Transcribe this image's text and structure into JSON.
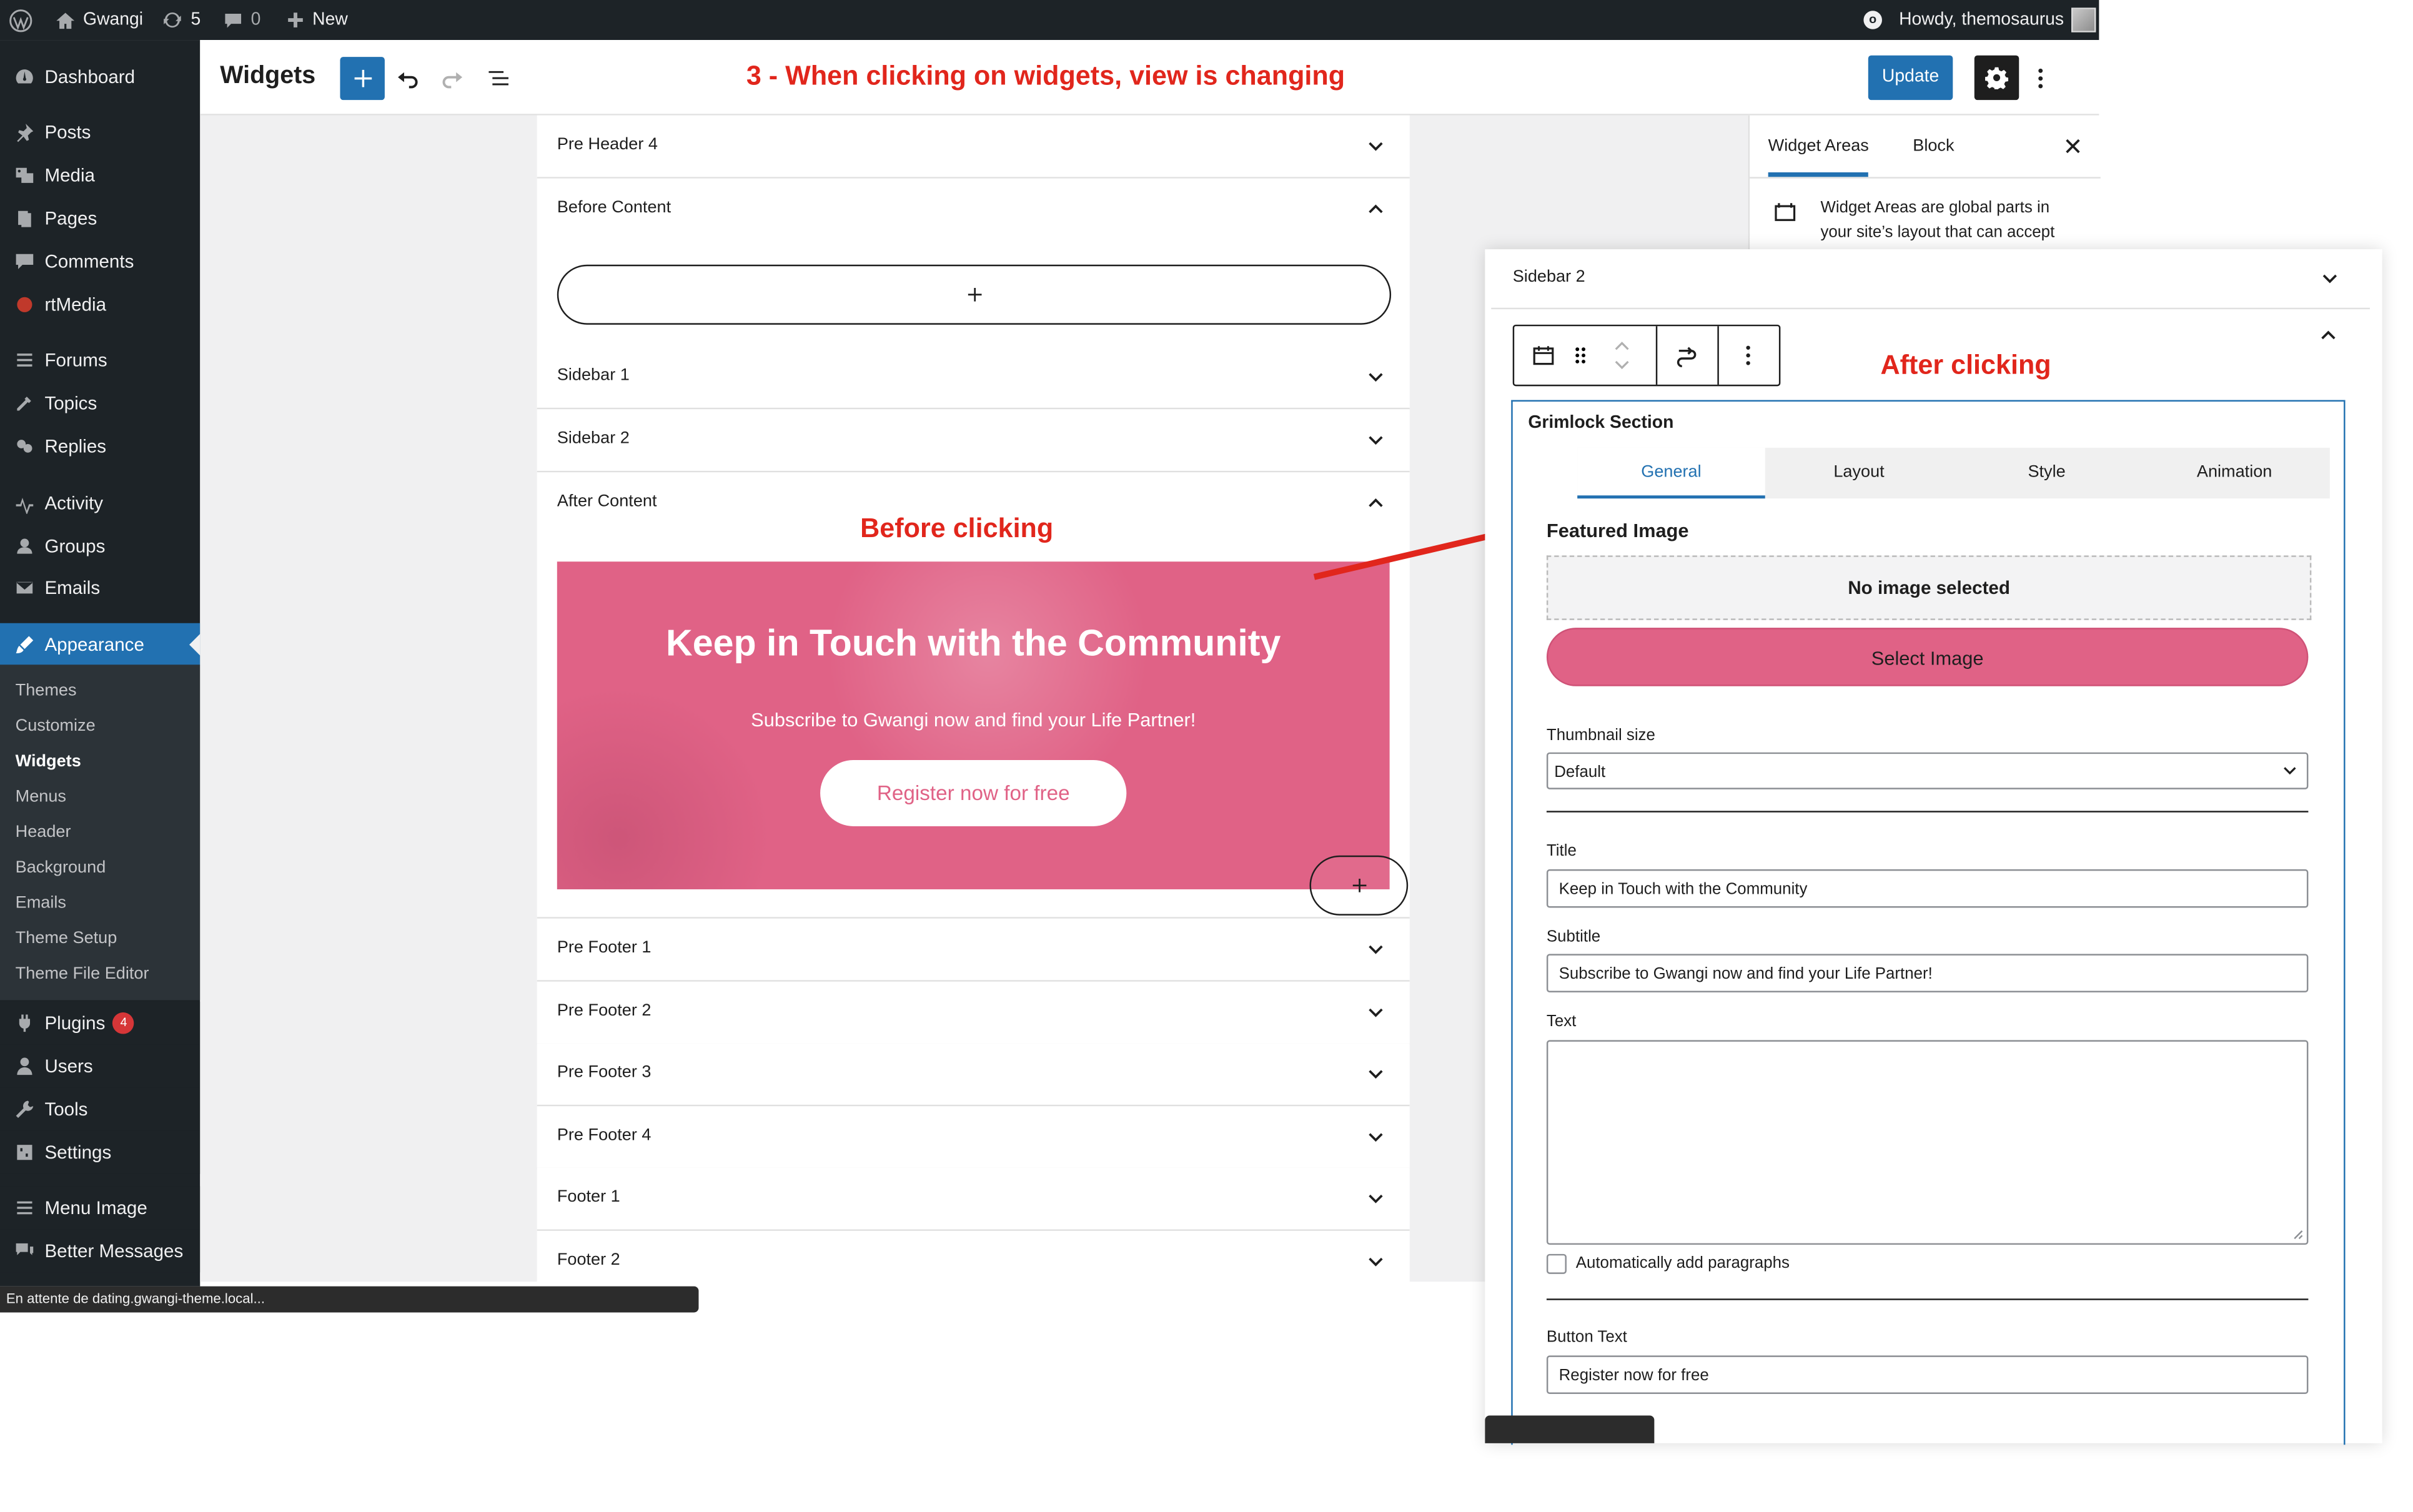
{
  "adminbar": {
    "site_name": "Gwangi",
    "updates_count": "5",
    "comments_count": "0",
    "new_label": "New",
    "howdy": "Howdy, themosaurus"
  },
  "menu": {
    "items": [
      {
        "label": "Dashboard",
        "icon": "dashboard-icon"
      },
      {
        "label": "Posts",
        "icon": "pin-icon"
      },
      {
        "label": "Media",
        "icon": "media-icon"
      },
      {
        "label": "Pages",
        "icon": "pages-icon"
      },
      {
        "label": "Comments",
        "icon": "comment-icon"
      },
      {
        "label": "rtMedia",
        "icon": "rtmedia-icon"
      },
      {
        "label": "Forums",
        "icon": "forums-icon"
      },
      {
        "label": "Topics",
        "icon": "topics-icon"
      },
      {
        "label": "Replies",
        "icon": "replies-icon"
      },
      {
        "label": "Activity",
        "icon": "activity-icon"
      },
      {
        "label": "Groups",
        "icon": "groups-icon"
      },
      {
        "label": "Emails",
        "icon": "email-icon"
      },
      {
        "label": "Appearance",
        "icon": "brush-icon"
      },
      {
        "label": "Plugins",
        "icon": "plugin-icon",
        "badge": "4"
      },
      {
        "label": "Users",
        "icon": "user-icon"
      },
      {
        "label": "Tools",
        "icon": "wrench-icon"
      },
      {
        "label": "Settings",
        "icon": "settings-icon"
      },
      {
        "label": "Menu Image",
        "icon": "menu-icon"
      },
      {
        "label": "Better Messages",
        "icon": "messages-icon"
      }
    ],
    "submenu": [
      "Themes",
      "Customize",
      "Widgets",
      "Menus",
      "Header",
      "Background",
      "Emails",
      "Theme Setup",
      "Theme File Editor"
    ]
  },
  "editor": {
    "title": "Widgets",
    "update_label": "Update",
    "annotation_top": "3 - When clicking on widgets, view is changing",
    "annotation_before": "Before clicking",
    "annotation_after": "After clicking"
  },
  "areas": [
    "Pre Header 4",
    "Before Content",
    "Sidebar 1",
    "Sidebar 2",
    "After Content",
    "Pre Footer 1",
    "Pre Footer 2",
    "Pre Footer 3",
    "Pre Footer 4",
    "Footer 1",
    "Footer 2"
  ],
  "banner": {
    "title": "Keep in Touch with the Community",
    "subtitle": "Subscribe to Gwangi now and find your Life Partner!",
    "button": "Register now for free",
    "color": "#e06286"
  },
  "statusbar": "En attente de dating.gwangi-theme.local...",
  "sidebar": {
    "tabs": [
      "Widget Areas",
      "Block"
    ],
    "description": "Widget Areas are global parts in your site’s layout that can accept"
  },
  "overlay": {
    "area_label": "Sidebar 2",
    "block_title": "Grimlock Section",
    "tabs": [
      "General",
      "Layout",
      "Style",
      "Animation"
    ],
    "featured_image": "Featured Image",
    "no_image": "No image selected",
    "select_image": "Select Image",
    "thumbnail_label": "Thumbnail size",
    "thumbnail_value": "Default",
    "title_label": "Title",
    "title_value": "Keep in Touch with the Community",
    "subtitle_label": "Subtitle",
    "subtitle_value": "Subscribe to Gwangi now and find your Life Partner!",
    "text_label": "Text",
    "auto_paragraphs": "Automatically add paragraphs",
    "button_text_label": "Button Text",
    "button_text_value": "Register now for free"
  },
  "colors": {
    "accent": "#2271b1",
    "annotation": "#e1261c",
    "admin_dark": "#1d2327"
  }
}
